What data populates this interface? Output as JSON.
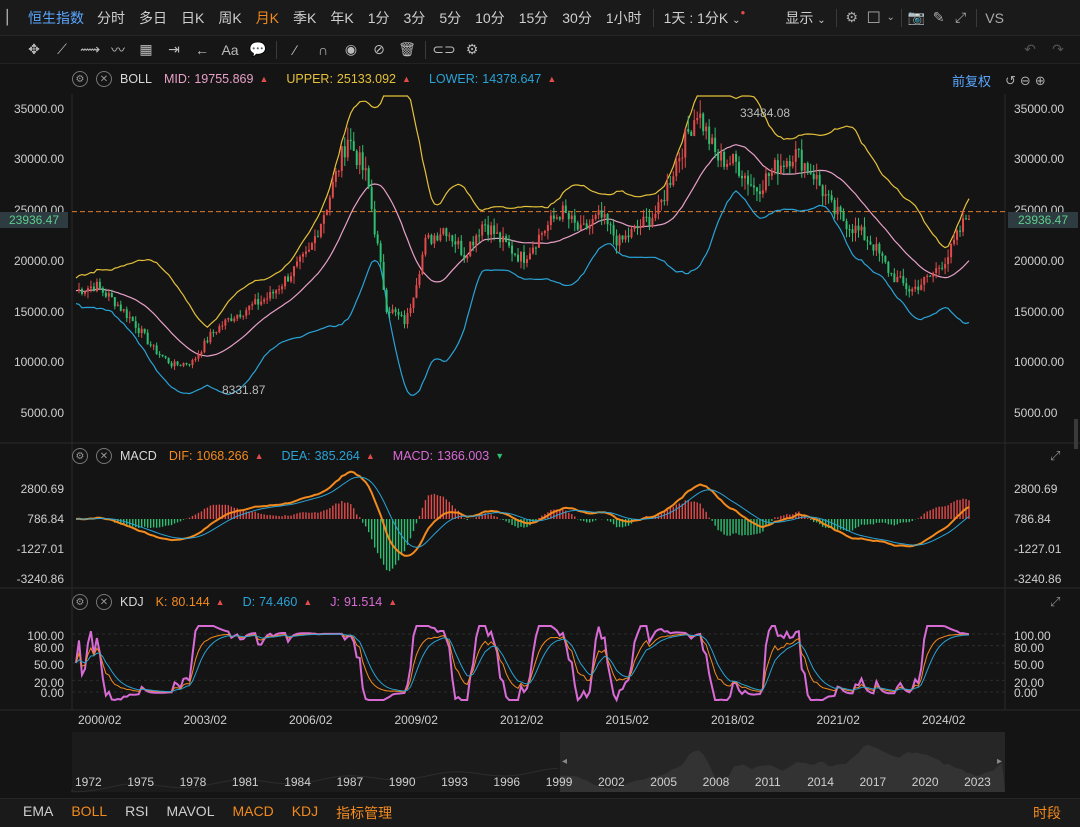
{
  "topbar": {
    "brand": "恒生指数",
    "periods": [
      "分时",
      "多日",
      "日K",
      "周K",
      "月K",
      "季K",
      "年K",
      "1分",
      "3分",
      "5分",
      "10分",
      "15分",
      "30分",
      "1小时"
    ],
    "active_period": "月K",
    "range_dropdown": "1天 : 1分K",
    "display_label": "显示",
    "vs_label": "VS"
  },
  "boll": {
    "name": "BOLL",
    "mid_label": "MID:",
    "mid": "19755.869",
    "upper_label": "UPPER:",
    "upper": "25133.092",
    "lower_label": "LOWER:",
    "lower": "14378.647",
    "adjust": "前复权",
    "yaxis": [
      "35000.00",
      "30000.00",
      "25000.00",
      "20000.00",
      "15000.00",
      "10000.00",
      "5000.00"
    ],
    "current_price": "23936.47",
    "high_label": "33484.08",
    "low_label": "8331.87",
    "colors": {
      "mid": "#e8a0c8",
      "upper": "#e5c13a",
      "lower": "#2aa3d6",
      "up": "#e24b4b",
      "down": "#2fbf71"
    }
  },
  "macd": {
    "name": "MACD",
    "dif_label": "DIF:",
    "dif": "1068.266",
    "dea_label": "DEA:",
    "dea": "385.264",
    "macd_label": "MACD:",
    "macd": "1366.003",
    "yaxis": [
      "2800.69",
      "786.84",
      "-1227.01",
      "-3240.86"
    ]
  },
  "kdj": {
    "name": "KDJ",
    "k_label": "K:",
    "k": "80.144",
    "d_label": "D:",
    "d": "74.460",
    "j_label": "J:",
    "j": "91.514",
    "yaxis": [
      "100.00",
      "80.00",
      "50.00",
      "20.00",
      "0.00"
    ]
  },
  "xaxis": [
    "2000/02",
    "2003/02",
    "2006/02",
    "2009/02",
    "2012/02",
    "2015/02",
    "2018/02",
    "2021/02",
    "2024/02"
  ],
  "overview_years": [
    "1972",
    "1975",
    "1978",
    "1981",
    "1984",
    "1987",
    "1990",
    "1993",
    "1996",
    "1999",
    "2002",
    "2005",
    "2008",
    "2011",
    "2014",
    "2017",
    "2020",
    "2023"
  ],
  "bottom_tabs": [
    "EMA",
    "BOLL",
    "RSI",
    "MAVOL",
    "MACD",
    "KDJ",
    "指标管理"
  ],
  "bottom_active": [
    "BOLL",
    "MACD",
    "KDJ",
    "指标管理"
  ],
  "bottom_right": "时段",
  "chart_data": {
    "type": "candlestick",
    "series_approx_close": [
      16500,
      17000,
      15500,
      13500,
      11000,
      9500,
      9800,
      12500,
      14000,
      15000,
      16000,
      18000,
      20000,
      25000,
      31000,
      27000,
      15000,
      13500,
      21000,
      22500,
      20000,
      23000,
      21000,
      19500,
      22000,
      24000,
      22000,
      23500,
      21000,
      22500,
      24000,
      29000,
      33484,
      29000,
      28500,
      26000,
      28000,
      29500,
      27500,
      24000,
      22500,
      21000,
      18000,
      16500,
      17800,
      20000,
      23936
    ],
    "x_start": "2000/02",
    "x_end": "2024/02+",
    "ymin": 5000,
    "ymax": 35000
  }
}
